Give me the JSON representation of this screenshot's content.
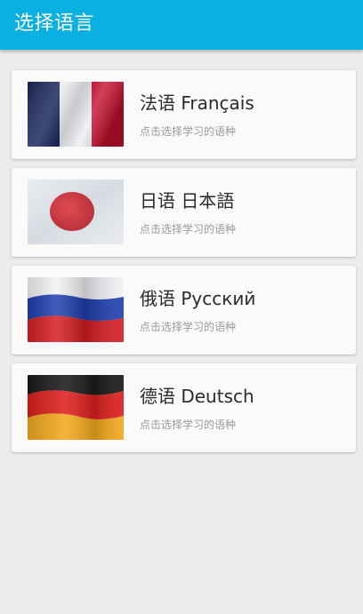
{
  "appbar": {
    "title": "选择语言"
  },
  "languages": [
    {
      "title": "法语 Français",
      "subtitle": "点击选择学习的语种",
      "flag_icon": "france-flag-icon"
    },
    {
      "title": "日语 日本語",
      "subtitle": "点击选择学习的语种",
      "flag_icon": "japan-flag-icon"
    },
    {
      "title": "俄语 Русский",
      "subtitle": "点击选择学习的语种",
      "flag_icon": "russia-flag-icon"
    },
    {
      "title": "德语 Deutsch",
      "subtitle": "点击选择学习的语种",
      "flag_icon": "germany-flag-icon"
    }
  ],
  "colors": {
    "appbar": "#0ab0e2",
    "background": "#ececec",
    "card": "#fafafa"
  }
}
